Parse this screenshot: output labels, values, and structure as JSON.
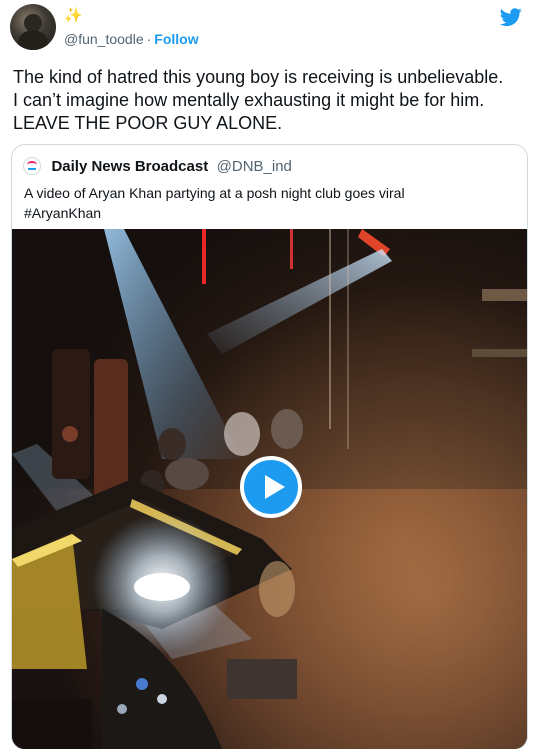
{
  "author": {
    "handle": "@fun_toodle",
    "separator": "·",
    "follow_label": "Follow",
    "emoji": "✨",
    "avatar_icon": "user-avatar"
  },
  "tweet": {
    "lines": [
      "The kind of hatred this young boy is receiving is unbelievable.",
      "I can’t imagine how mentally exhausting it might be for him.",
      "LEAVE THE POOR GUY ALONE."
    ]
  },
  "quoted": {
    "name": "Daily News Broadcast",
    "handle": "@DNB_ind",
    "lines": [
      "A video of Aryan Khan partying at a posh night club goes viral",
      "#AryanKhan"
    ]
  },
  "icons": {
    "logo": "twitter-bird-icon",
    "play": "play-icon"
  },
  "colors": {
    "accent": "#1d9bf0",
    "text": "#0f1419",
    "muted": "#536471",
    "border": "#cfd9de"
  }
}
